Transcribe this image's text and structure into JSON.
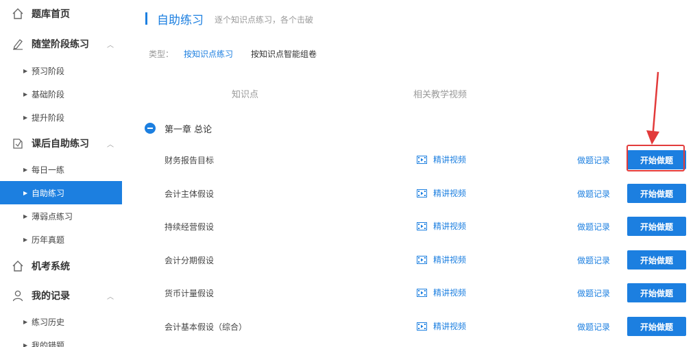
{
  "sidebar": {
    "home": {
      "label": "题库首页",
      "icon": "home-icon"
    },
    "classroom": {
      "label": "随堂阶段练习",
      "icon": "pencil-icon",
      "items": [
        "预习阶段",
        "基础阶段",
        "提升阶段"
      ]
    },
    "after_class": {
      "label": "课后自助练习",
      "icon": "notebook-icon",
      "items": [
        "每日一练",
        "自助练习",
        "薄弱点练习",
        "历年真题"
      ],
      "active_item": "自助练习"
    },
    "exam": {
      "label": "机考系统",
      "icon": "home-icon"
    },
    "records": {
      "label": "我的记录",
      "icon": "user-icon",
      "items": [
        "练习历史",
        "我的错题"
      ]
    }
  },
  "main": {
    "title": "自助练习",
    "subtitle": "逐个知识点练习，各个击破",
    "type_label": "类型：",
    "type_options": [
      "按知识点练习",
      "按知识点智能组卷"
    ],
    "selected_type": "按知识点练习",
    "col_headers": [
      "知识点",
      "相关教学视频"
    ],
    "chapter": "第一章 总论",
    "rows": [
      {
        "name": "财务报告目标",
        "video": "精讲视频",
        "record": "做题记录",
        "start": "开始做题"
      },
      {
        "name": "会计主体假设",
        "video": "精讲视频",
        "record": "做题记录",
        "start": "开始做题"
      },
      {
        "name": "持续经营假设",
        "video": "精讲视频",
        "record": "做题记录",
        "start": "开始做题"
      },
      {
        "name": "会计分期假设",
        "video": "精讲视频",
        "record": "做题记录",
        "start": "开始做题"
      },
      {
        "name": "货币计量假设",
        "video": "精讲视频",
        "record": "做题记录",
        "start": "开始做题"
      },
      {
        "name": "会计基本假设（综合）",
        "video": "精讲视频",
        "record": "做题记录",
        "start": "开始做题"
      }
    ]
  },
  "colors": {
    "accent": "#1c7fe0",
    "annotation": "#e23a3a"
  }
}
